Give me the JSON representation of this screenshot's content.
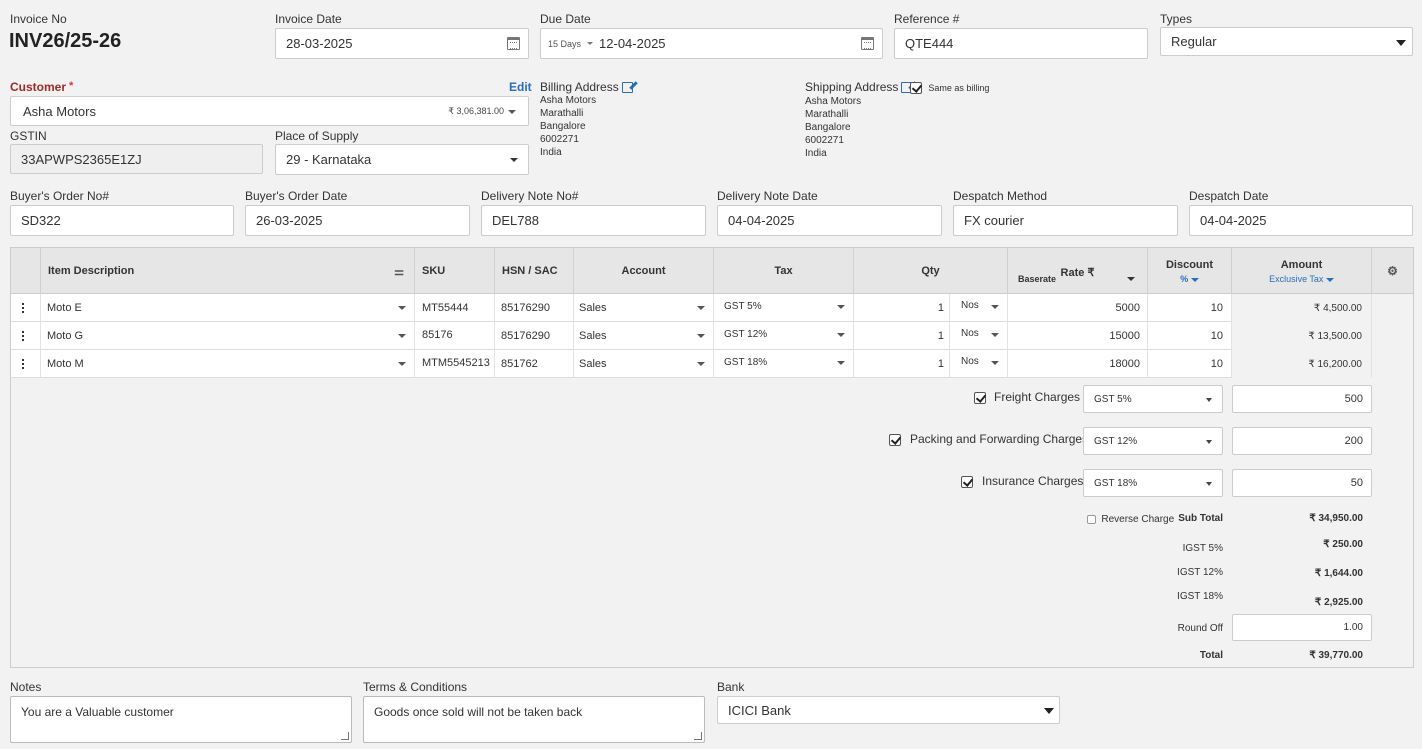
{
  "header": {
    "invoice_no_label": "Invoice No",
    "invoice_no": "INV26/25-26",
    "invoice_date_label": "Invoice Date",
    "invoice_date": "28-03-2025",
    "due_date_label": "Due Date",
    "due_terms": "15 Days",
    "due_date": "12-04-2025",
    "reference_label": "Reference #",
    "reference": "QTE444",
    "types_label": "Types",
    "types_value": "Regular"
  },
  "customer": {
    "label": "Customer",
    "required_mark": "*",
    "edit_label": "Edit",
    "name": "Asha Motors",
    "balance": "₹ 3,06,381.00",
    "gstin_label": "GSTIN",
    "gstin": "33APWPS2365E1ZJ",
    "place_label": "Place of Supply",
    "place_value": "29 - Karnataka"
  },
  "billing": {
    "label": "Billing Address",
    "lines": [
      "Asha Motors",
      "Marathalli",
      "Bangalore",
      "6002271",
      "India"
    ]
  },
  "shipping": {
    "label": "Shipping Address",
    "same_label": "Same as billing",
    "lines": [
      "Asha Motors",
      "Marathalli",
      "Bangalore",
      "6002271",
      "India"
    ]
  },
  "order": {
    "buyers_order_no_label": "Buyer's Order No#",
    "buyers_order_no": "SD322",
    "buyers_order_date_label": "Buyer's Order Date",
    "buyers_order_date": "26-03-2025",
    "delivery_note_no_label": "Delivery Note No#",
    "delivery_note_no": "DEL788",
    "delivery_note_date_label": "Delivery Note Date",
    "delivery_note_date": "04-04-2025",
    "despatch_method_label": "Despatch Method",
    "despatch_method": "FX courier",
    "despatch_date_label": "Despatch Date",
    "despatch_date": "04-04-2025"
  },
  "table": {
    "columns": {
      "item": "Item Description",
      "sku": "SKU",
      "hsn": "HSN / SAC",
      "account": "Account",
      "tax": "Tax",
      "qty": "Qty",
      "rate": "Rate ₹",
      "rate_sub": "Baserate",
      "discount": "Discount",
      "discount_sub": "%",
      "amount": "Amount",
      "amount_sub": "Exclusive Tax"
    },
    "rows": [
      {
        "item": "Moto E",
        "sku": "MT55444",
        "hsn": "85176290",
        "account": "Sales",
        "tax": "GST 5%",
        "qty": "1",
        "unit": "Nos",
        "rate": "5000",
        "discount": "10",
        "amount": "₹ 4,500.00"
      },
      {
        "item": "Moto G",
        "sku": "85176",
        "hsn": "85176290",
        "account": "Sales",
        "tax": "GST 12%",
        "qty": "1",
        "unit": "Nos",
        "rate": "15000",
        "discount": "10",
        "amount": "₹ 13,500.00"
      },
      {
        "item": "Moto M",
        "sku": "MTM5545213",
        "hsn": "851762",
        "account": "Sales",
        "tax": "GST 18%",
        "qty": "1",
        "unit": "Nos",
        "rate": "18000",
        "discount": "10",
        "amount": "₹ 16,200.00"
      }
    ]
  },
  "charges": [
    {
      "label": "Freight Charges",
      "tax": "GST 5%",
      "amount": "500"
    },
    {
      "label": "Packing and Forwarding Charges",
      "tax": "GST 12%",
      "amount": "200"
    },
    {
      "label": "Insurance Charges",
      "tax": "GST 18%",
      "amount": "50"
    }
  ],
  "totals": {
    "reverse_charge_label": "Reverse Charge",
    "subtotal_label": "Sub Total",
    "subtotal": "₹ 34,950.00",
    "igst5_label": "IGST 5%",
    "igst5": "₹ 250.00",
    "igst12_label": "IGST 12%",
    "igst12": "₹ 1,644.00",
    "igst18_label": "IGST 18%",
    "igst18": "₹ 2,925.00",
    "roundoff_label": "Round Off",
    "roundoff": "1.00",
    "total_label": "Total",
    "total": "₹ 39,770.00"
  },
  "footer": {
    "notes_label": "Notes",
    "notes": "You are a Valuable customer",
    "terms_label": "Terms & Conditions",
    "terms": "Goods once sold will not be taken back",
    "bank_label": "Bank",
    "bank": "ICICI Bank"
  }
}
